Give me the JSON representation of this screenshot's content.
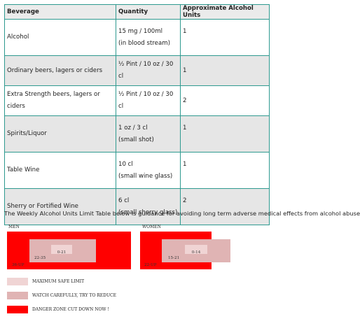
{
  "table": {
    "headers": [
      "Beverage",
      "Quantity",
      "Approximate Alcohol Units"
    ],
    "rows": [
      {
        "beverage": "Alcohol",
        "quantity": "15 mg / 100ml",
        "quantity_note": "(in blood stream)",
        "units": "1"
      },
      {
        "beverage": "Ordinary beers, lagers or ciders",
        "quantity": "½ Pint / 10 oz / 30 cl",
        "quantity_note": "",
        "units": "1"
      },
      {
        "beverage": "Extra Strength beers, lagers or ciders",
        "quantity": "½ Pint / 10 oz / 30 cl",
        "quantity_note": "",
        "units": "2"
      },
      {
        "beverage": "Spirits/Liquor",
        "quantity": "1 oz / 3 cl",
        "quantity_note": "(small shot)",
        "units": "1"
      },
      {
        "beverage": "Table Wine",
        "quantity": "10 cl",
        "quantity_note": "(small wine glass)",
        "units": "1"
      },
      {
        "beverage": "Sherry or Fortified Wine",
        "quantity": "6 cl",
        "quantity_note": "(small sherry glass)",
        "units": "2"
      }
    ]
  },
  "note": "The Weekly Alcohol Units Limit Table below is guidance for avoiding long term adverse medical effects from alcohol abuse.",
  "men": {
    "label": "MEN",
    "safe": "0-21",
    "watch": "22-35",
    "danger": "36-UP"
  },
  "women": {
    "label": "WOMEN",
    "safe": "0-14",
    "watch": "15-21",
    "danger": "22-UP"
  },
  "legend": {
    "safe": "MAXIMUM SAFE LIMIT",
    "watch": "WATCH CAREFULLY, TRY TO REDUCE",
    "danger": "DANGER ZONE CUT DOWN NOW !"
  },
  "colors": {
    "danger": "#ff0000",
    "watch": "#e0b4b4",
    "safe": "#f0d4d4",
    "border": "#2f9a90"
  }
}
